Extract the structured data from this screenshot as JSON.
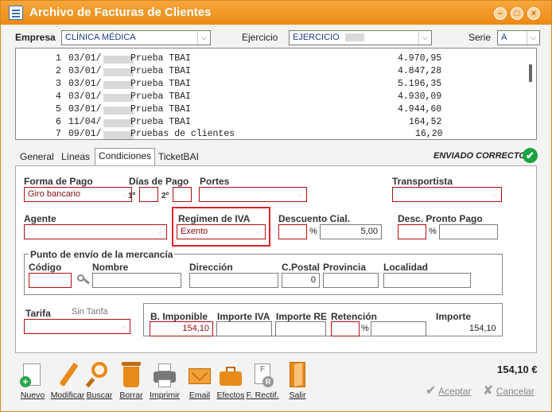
{
  "window": {
    "title": "Archivo de Facturas de Clientes",
    "minimize_glyph": "–",
    "maximize_glyph": "□",
    "close_glyph": "×"
  },
  "header": {
    "empresa_label": "Empresa",
    "empresa_value": "CLÍNICA MÉDICA",
    "ejercicio_label": "Ejercicio",
    "ejercicio_value": "EJERCICIO",
    "serie_label": "Serie",
    "serie_value": "A"
  },
  "invoices": [
    {
      "n": "1",
      "date": "03/01/",
      "desc": "Prueba TBAI",
      "amount": "4.970,95"
    },
    {
      "n": "2",
      "date": "03/01/",
      "desc": "Prueba TBAI",
      "amount": "4.847,28"
    },
    {
      "n": "3",
      "date": "03/01/",
      "desc": "Prueba TBAI",
      "amount": "5.196,35"
    },
    {
      "n": "4",
      "date": "03/01/",
      "desc": "Prueba TBAI",
      "amount": "4.930,09"
    },
    {
      "n": "5",
      "date": "03/01/",
      "desc": "Prueba TBAI",
      "amount": "4.944,60"
    },
    {
      "n": "6",
      "date": "11/04/",
      "desc": "Prueba TBAI",
      "amount": "164,52"
    },
    {
      "n": "7",
      "date": "09/01/",
      "desc": "Pruebas de clientes",
      "amount": "16,20"
    }
  ],
  "tabs": {
    "general": "General",
    "lineas": "Líneas",
    "condiciones": "Condiciones",
    "ticketbai": "TicketBAI"
  },
  "status": {
    "text": "ENVIADO CORRECTO",
    "check_glyph": "✔"
  },
  "form": {
    "forma_pago_label": "Forma de Pago",
    "forma_pago_value": "Giro bancario",
    "dias_pago_label": "Días de Pago",
    "dia1_label": "1º",
    "dia2_label": "2º",
    "portes_label": "Portes",
    "transportista_label": "Transportista",
    "agente_label": "Agente",
    "regimen_iva_label": "Regimen de IVA",
    "regimen_iva_value": "Exento",
    "descuento_label": "Descuento Cial.",
    "descuento_pct": "%",
    "descuento_value": "5,00",
    "desc_pronto_label": "Desc. Pronto Pago",
    "desc_pronto_pct": "%",
    "punto_envio_label": "Punto de envío de la mercancía",
    "codigo_label": "Código",
    "nombre_label": "Nombre",
    "direccion_label": "Dirección",
    "cpostal_label": "C.Postal",
    "cpostal_value": "0",
    "provincia_label": "Provincia",
    "localidad_label": "Localidad",
    "tarifa_label": "Tarifa",
    "tarifa_hint": "Sin Tarifa",
    "b_imponible_label": "B. Imponible",
    "b_imponible_value": "154,10",
    "importe_iva_label": "Importe IVA",
    "importe_re_label": "Importe RE",
    "retencion_label": "Retención",
    "retencion_pct": "%",
    "importe_label": "Importe",
    "importe_value": "154,10"
  },
  "toolbar": {
    "nuevo": "Nuevo",
    "modificar": "Modificar",
    "buscar": "Buscar",
    "borrar": "Borrar",
    "imprimir": "Imprimir",
    "email": "Email",
    "efectos": "Efectos",
    "f_rectif": "F. Rectif.",
    "salir": "Salir"
  },
  "footer": {
    "total": "154,10 €",
    "aceptar": "Aceptar",
    "cancelar": "Cancelar"
  },
  "colors": {
    "title_bar": "#ee8c18",
    "required_border": "#b01010",
    "highlight": "#e0202a",
    "ok_green": "#1aa33f"
  }
}
